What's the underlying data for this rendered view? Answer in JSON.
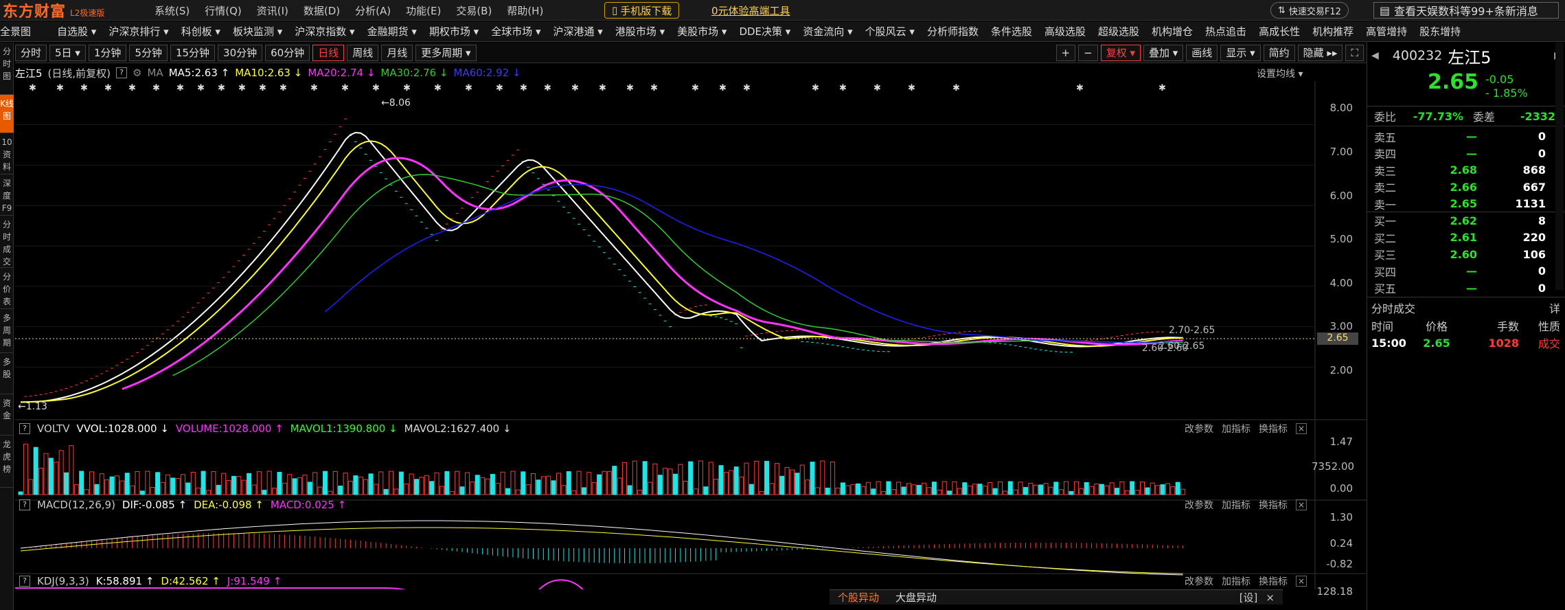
{
  "brand": {
    "name": "东方财富",
    "edition": "L2极速版"
  },
  "menu": [
    "系统(S)",
    "行情(Q)",
    "资讯(I)",
    "数据(D)",
    "分析(A)",
    "功能(E)",
    "交易(B)",
    "帮助(H)"
  ],
  "promo": {
    "mobile": "手机版下载",
    "tool": "0元体验高端工具",
    "quick": "快速交易F12",
    "news": "查看天娱数科等99+条新消息"
  },
  "nav": [
    "全景图",
    "自选股 ▾",
    "沪深京排行 ▾",
    "科创板 ▾",
    "板块监测 ▾",
    "沪深京指数 ▾",
    "金融期货 ▾",
    "期权市场 ▾",
    "全球市场 ▾",
    "沪深港通 ▾",
    "港股市场 ▾",
    "美股市场 ▾",
    "DDE决策 ▾",
    "资金流向 ▾",
    "个股风云 ▾",
    "分析师指数",
    "条件选股",
    "高级选股",
    "超级选股",
    "机构增仓",
    "热点追击",
    "高成长性",
    "机构推荐",
    "高管增持",
    "股东增持"
  ],
  "left_strip": [
    "分时图",
    "K线图",
    "10资料",
    "深度F9",
    "分时成交",
    "分价表",
    "多周期",
    "多股",
    "资金",
    "龙虎榜"
  ],
  "periods": [
    "分时",
    "5日 ▾",
    "1分钟",
    "5分钟",
    "15分钟",
    "30分钟",
    "60分钟",
    "日线",
    "周线",
    "月线",
    "更多周期 ▾"
  ],
  "toolbar_right": [
    "+",
    "−",
    "复权 ▾",
    "叠加 ▾",
    "画线",
    "显示 ▾",
    "简约",
    "隐藏 ▸▸"
  ],
  "info": {
    "name": "左江5",
    "mode": "(日线,前复权)",
    "ma": "MA",
    "ma5": "MA5:2.63 ↑",
    "ma10": "MA10:2.63 ↓",
    "ma20": "MA20:2.74 ↓",
    "ma30": "MA30:2.76 ↓",
    "ma60": "MA60:2.92 ↓",
    "set": "设置均线 ▾"
  },
  "price_axis": [
    "8.00",
    "7.00",
    "6.00",
    "5.00",
    "4.00",
    "3.00",
    "2.00"
  ],
  "price_current": "2.65",
  "annotations": {
    "high": "←8.06",
    "low": "←1.13",
    "last1": "2.70-2.65",
    "last2": "2.60-2.65",
    "last3": "2.60-2.60"
  },
  "volume": {
    "label": "VOLTV",
    "vvol": "VVOL:1028.000 ↓",
    "vol": "VOLUME:1028.000 ↑",
    "mavol1": "MAVOL1:1390.800 ↓",
    "mavol2": "MAVOL2:1627.400 ↓",
    "axis": [
      "1.47",
      "7352.00",
      "0.00"
    ]
  },
  "macd": {
    "label": "MACD(12,26,9)",
    "dif": "DIF:-0.085 ↑",
    "dea": "DEA:-0.098 ↑",
    "macd": "MACD:0.025 ↑",
    "axis": [
      "1.30",
      "0.24",
      "-0.82"
    ]
  },
  "kdj": {
    "label": "KDJ(9,3,3)",
    "k": "K:58.891 ↑",
    "d": "D:42.562 ↑",
    "j": "J:91.549 ↑",
    "axis": [
      "128.18"
    ]
  },
  "subctl": [
    "改参数",
    "加指标",
    "换指标"
  ],
  "bottom_tabs": {
    "a": "个股异动",
    "b": "大盘异动",
    "set": "[设]",
    "close": "×"
  },
  "quote": {
    "code": "400232",
    "name": "左江5",
    "price": "2.65",
    "change": "-0.05",
    "change_pct": "- 1.85%",
    "webi_label": "委比",
    "webi": "-77.73%",
    "weicha_label": "委差",
    "weicha": "-2332"
  },
  "orderbook": [
    {
      "label": "卖五",
      "price": "—",
      "vol": "0"
    },
    {
      "label": "卖四",
      "price": "—",
      "vol": "0"
    },
    {
      "label": "卖三",
      "price": "2.68",
      "vol": "868"
    },
    {
      "label": "卖二",
      "price": "2.66",
      "vol": "667"
    },
    {
      "label": "卖一",
      "price": "2.65",
      "vol": "1131"
    },
    {
      "label": "买一",
      "price": "2.62",
      "vol": "8"
    },
    {
      "label": "买二",
      "price": "2.61",
      "vol": "220"
    },
    {
      "label": "买三",
      "price": "2.60",
      "vol": "106"
    },
    {
      "label": "买四",
      "price": "—",
      "vol": "0"
    },
    {
      "label": "买五",
      "price": "—",
      "vol": "0"
    }
  ],
  "trades": {
    "title": "分时成交",
    "detail": "详",
    "headers": [
      "时间",
      "价格",
      "手数",
      "性质"
    ],
    "rows": [
      {
        "time": "15:00",
        "price": "2.65",
        "qty": "1028",
        "type": "成交"
      }
    ]
  },
  "colors": {
    "ma5": "#ffffff",
    "ma10": "#ffff33",
    "ma20": "#ff33ff",
    "ma30": "#33cc33",
    "ma60": "#2020ff",
    "up": "#ff3b3b",
    "down": "#1ee6e6",
    "accent": "#e85a00"
  }
}
